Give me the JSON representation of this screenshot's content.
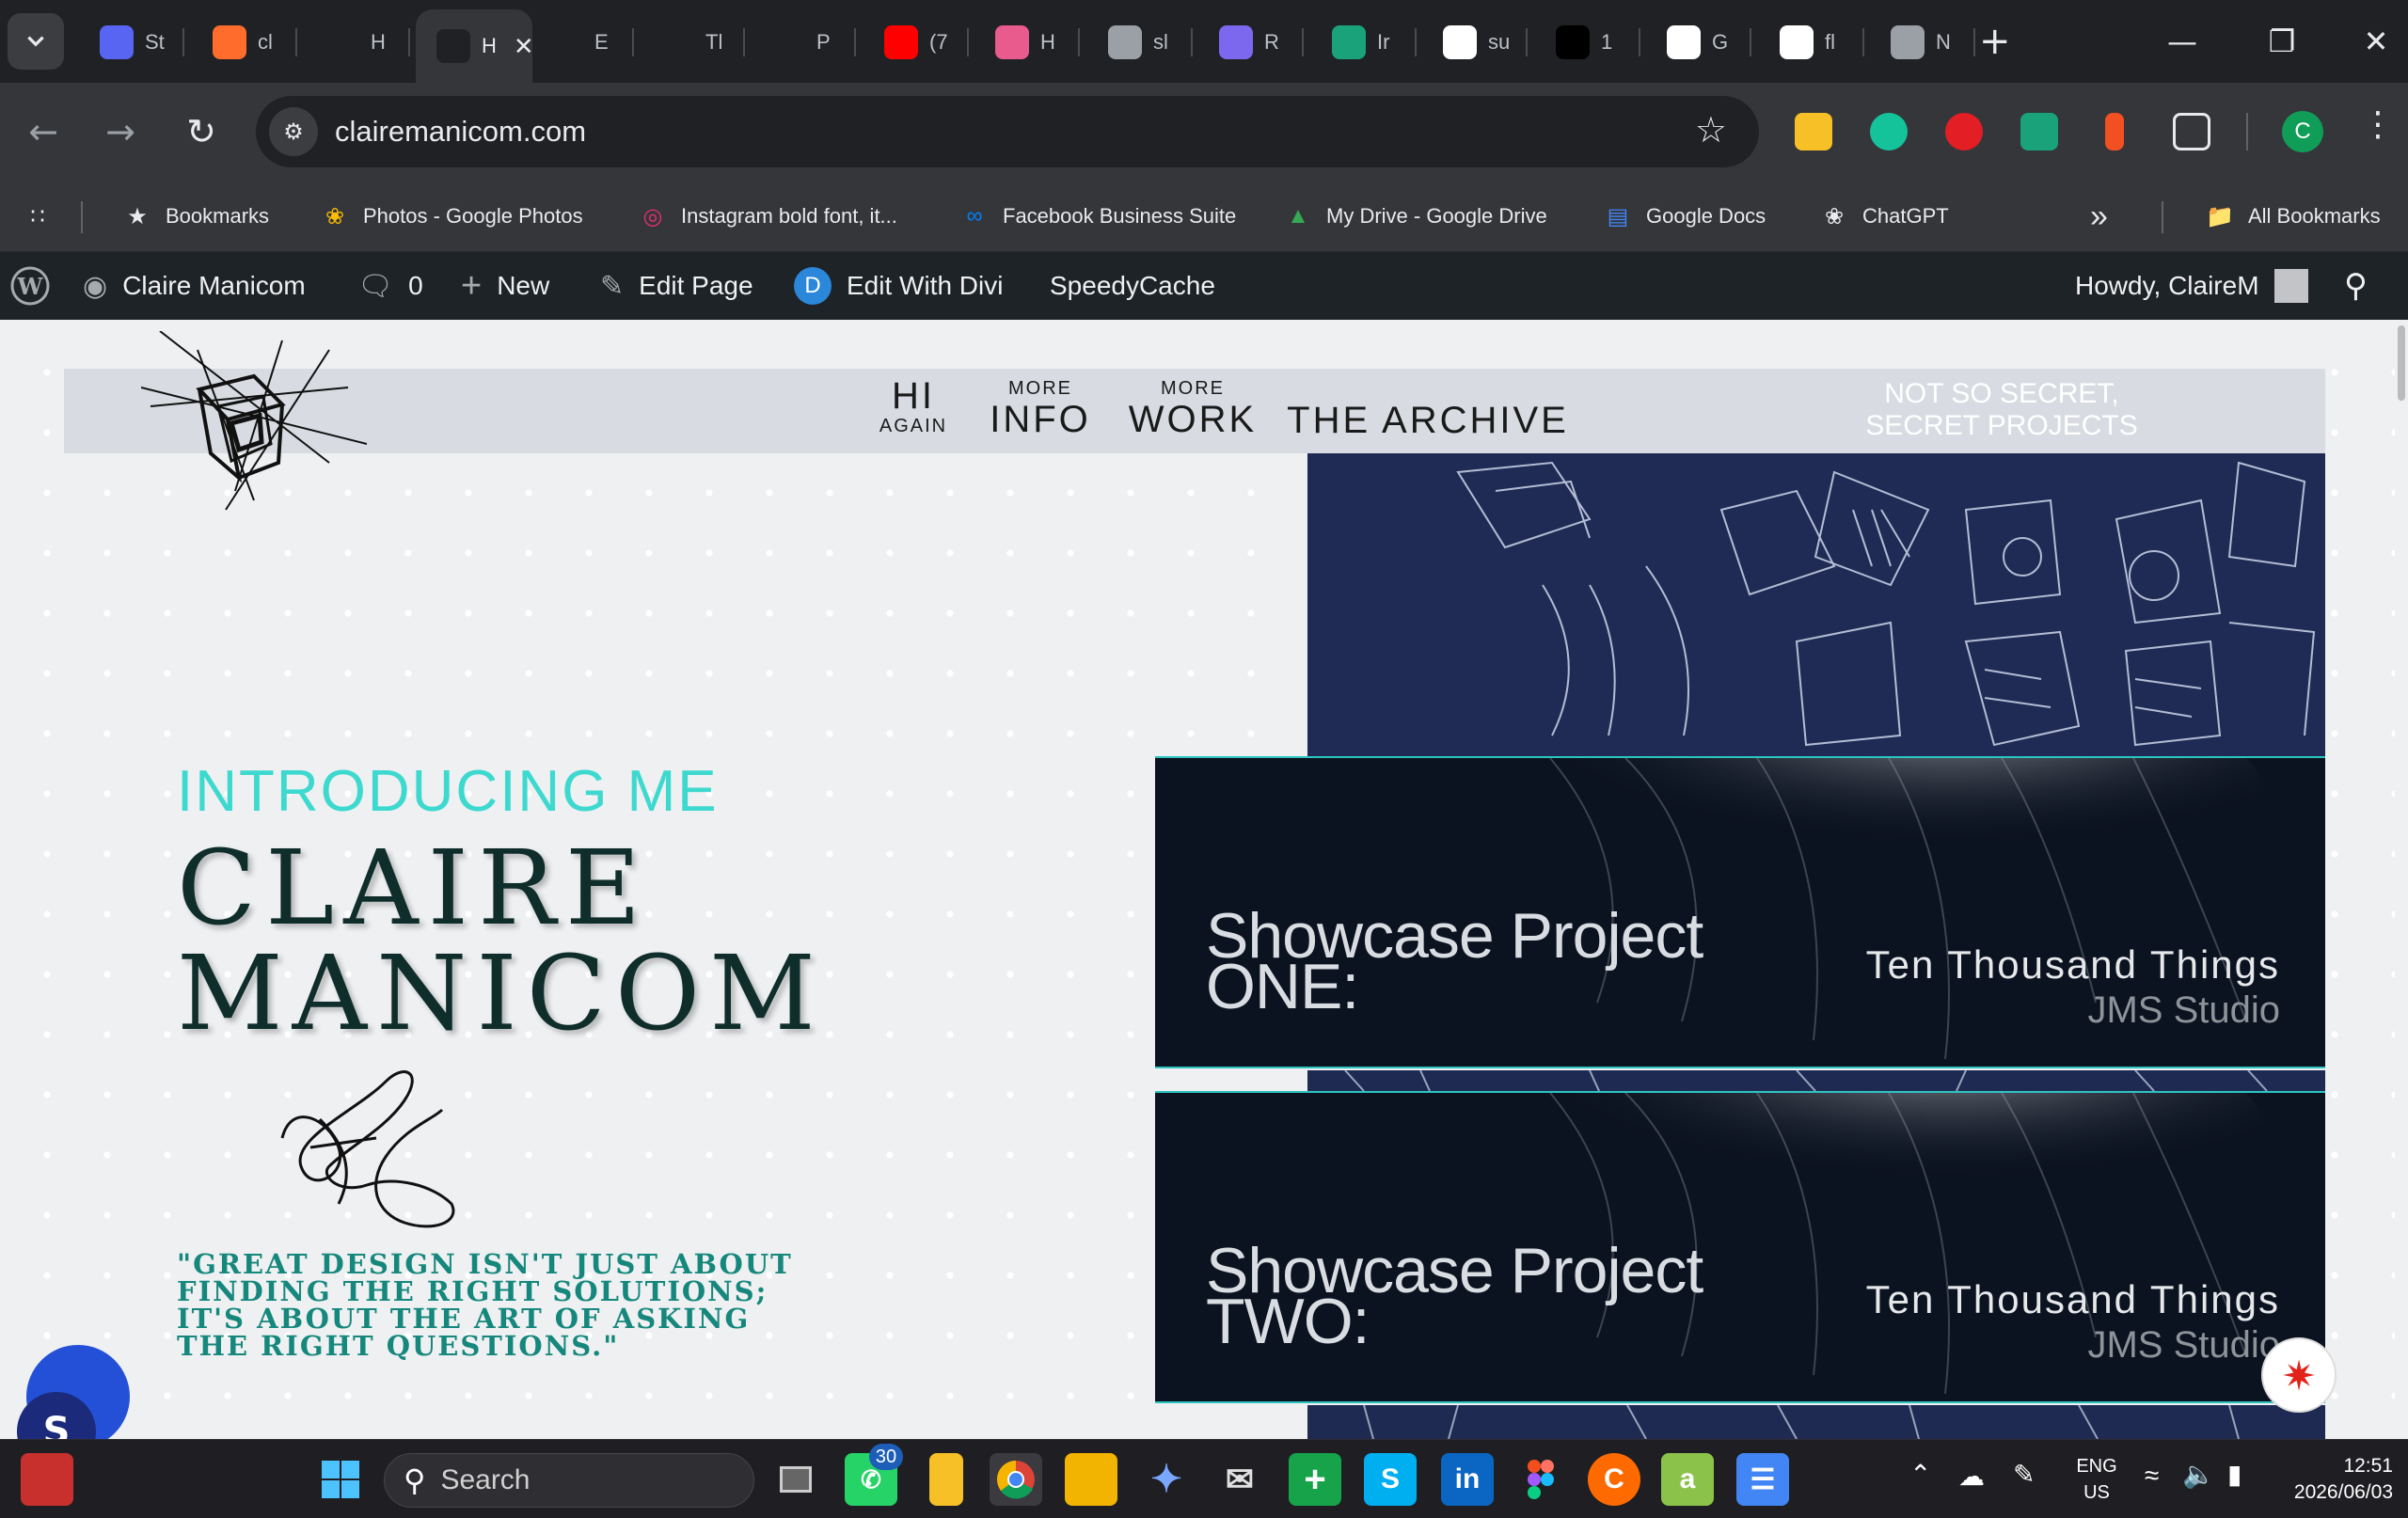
{
  "browser": {
    "tabs": [
      {
        "label": "St",
        "icon": "discord-icon",
        "color": "#5865f2"
      },
      {
        "label": "cl",
        "icon": "cpanel-icon",
        "color": "#ff6c2c"
      },
      {
        "label": "H",
        "icon": "black-heart-icon",
        "color": "#202124"
      },
      {
        "label": "H",
        "icon": "black-heart-icon",
        "color": "#202124",
        "active": true
      },
      {
        "label": "E",
        "icon": "black-heart-icon",
        "color": "#202124"
      },
      {
        "label": "Tl",
        "icon": "black-heart-icon",
        "color": "#202124"
      },
      {
        "label": "P",
        "icon": "black-heart-icon",
        "color": "#202124"
      },
      {
        "label": "(7",
        "icon": "youtube-icon",
        "color": "#ff0000"
      },
      {
        "label": "H",
        "icon": "asterisk-icon",
        "color": "#e85b8c"
      },
      {
        "label": "sl",
        "icon": "globe-icon",
        "color": "#9aa0a6"
      },
      {
        "label": "R",
        "icon": "miro-icon",
        "color": "#7b68ee"
      },
      {
        "label": "Ir",
        "icon": "green-diamond-icon",
        "color": "#1aa37a"
      },
      {
        "label": "su",
        "icon": "google-icon",
        "color": "#ffffff"
      },
      {
        "label": "1",
        "icon": "f-icon",
        "color": "#000000"
      },
      {
        "label": "G",
        "icon": "google-icon",
        "color": "#ffffff"
      },
      {
        "label": "fl",
        "icon": "google-icon",
        "color": "#ffffff"
      },
      {
        "label": "N",
        "icon": "chrome-icon",
        "color": "#9aa0a6"
      }
    ],
    "new_tab": "+",
    "url": "clairemanicom.com",
    "profile_initial": "C",
    "bookmarks": [
      {
        "label": "Bookmarks",
        "icon": "star-icon"
      },
      {
        "label": "Photos - Google Photos",
        "icon": "pinwheel-icon"
      },
      {
        "label": "Instagram bold font, it...",
        "icon": "instagram-icon"
      },
      {
        "label": "Facebook Business Suite",
        "icon": "meta-icon"
      },
      {
        "label": "My Drive - Google Drive",
        "icon": "drive-icon"
      },
      {
        "label": "Google Docs",
        "icon": "docs-icon"
      },
      {
        "label": "ChatGPT",
        "icon": "chatgpt-icon"
      }
    ],
    "more_bookmarks": "»",
    "all_bookmarks": "All Bookmarks"
  },
  "wp_admin": {
    "site_name": "Claire Manicom",
    "comments": "0",
    "new": "New",
    "edit_page": "Edit Page",
    "edit_divi": "Edit With Divi",
    "speedycache": "SpeedyCache",
    "howdy": "Howdy, ClaireM"
  },
  "site": {
    "nav": [
      {
        "small": "",
        "big": "HI",
        "sub": "AGAIN"
      },
      {
        "small": "MORE",
        "big": "INFO",
        "sub": ""
      },
      {
        "small": "MORE",
        "big": "WORK",
        "sub": ""
      },
      {
        "small": "",
        "big": "THE ARCHIVE",
        "sub": ""
      }
    ],
    "nav_secret": [
      "NOT SO SECRET,",
      "SECRET PROJECTS"
    ],
    "kicker": "INTRODUCING ME",
    "name_line1": "CLAIRE",
    "name_line2": "MANICOM",
    "quote": "\"GREAT DESIGN ISN'T JUST ABOUT FINDING THE RIGHT SOLUTIONS; IT'S ABOUT THE ART OF ASKING THE RIGHT QUESTIONS.\"",
    "projects": [
      {
        "title_line1": "Showcase Project",
        "title_line2": "ONE:",
        "client": "Ten Thousand Things",
        "studio": "JMS Studio"
      },
      {
        "title_line1": "Showcase Project",
        "title_line2": "TWO:",
        "client": "Ten Thousand Things",
        "studio": "JMS Studio"
      }
    ]
  },
  "taskbar": {
    "search_placeholder": "Search",
    "whatsapp_badge": "30",
    "lang_line1": "ENG",
    "lang_line2": "US",
    "time": "12:51",
    "date": "2026/06/03"
  },
  "colors": {
    "accent_teal": "#3dd9cf",
    "name_dark_green": "#0f2d2a",
    "quote_teal": "#15877c",
    "header_grey": "#d8dce2"
  }
}
